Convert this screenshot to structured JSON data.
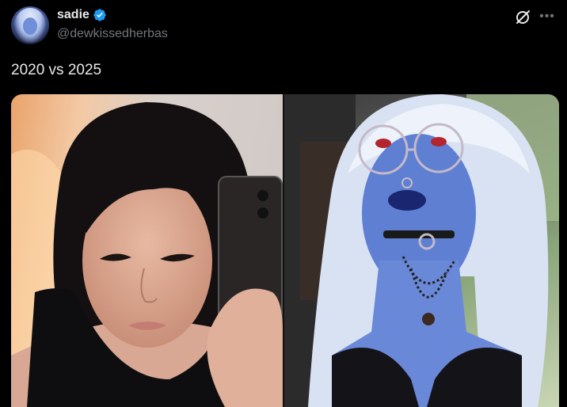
{
  "author": {
    "display_name": "sadie",
    "handle": "@dewkissedherbas",
    "verified": true
  },
  "post": {
    "text": "2020 vs 2025"
  },
  "icons": {
    "verified": "verified-badge-icon",
    "grok": "grok-icon",
    "more": "more-options-icon"
  },
  "colors": {
    "background": "#000000",
    "text_primary": "#e7e9ea",
    "text_secondary": "#71767b",
    "verified_blue": "#1d9bf0"
  },
  "media": {
    "images": [
      "photo-2020",
      "photo-2025"
    ]
  }
}
